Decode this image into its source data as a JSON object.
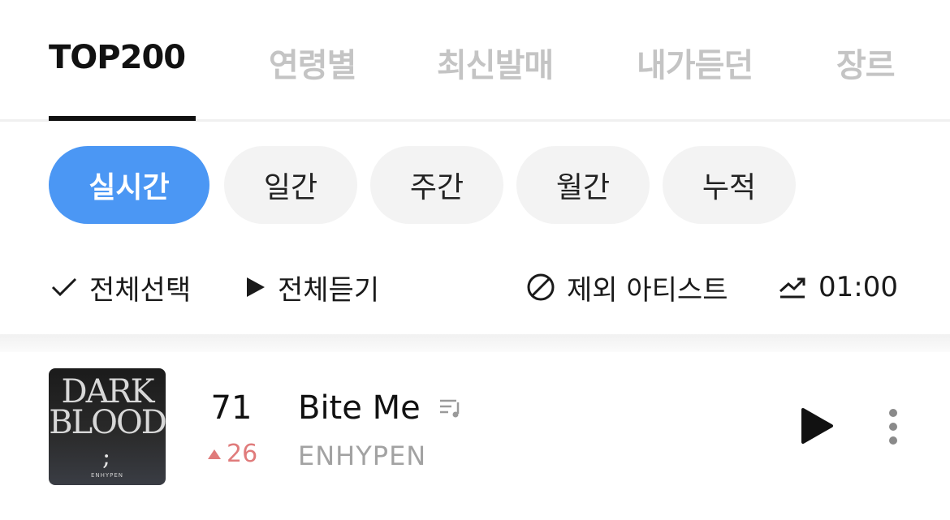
{
  "tabs": [
    {
      "label": "TOP200",
      "active": true
    },
    {
      "label": "연령별",
      "active": false
    },
    {
      "label": "최신발매",
      "active": false
    },
    {
      "label": "내가듣던",
      "active": false
    },
    {
      "label": "장르",
      "active": false
    }
  ],
  "periods": [
    {
      "label": "실시간",
      "active": true
    },
    {
      "label": "일간",
      "active": false
    },
    {
      "label": "주간",
      "active": false
    },
    {
      "label": "월간",
      "active": false
    },
    {
      "label": "누적",
      "active": false
    }
  ],
  "actions": {
    "select_all": "전체선택",
    "play_all": "전체듣기",
    "exclude_artist": "제외 아티스트",
    "chart_time": "01:00"
  },
  "song": {
    "rank": "71",
    "rank_change": "26",
    "rank_direction": "up",
    "title": "Bite Me",
    "artist": "ENHYPEN",
    "cover": {
      "line1": "DARK",
      "line2": "BLOOD",
      "mark": ";",
      "small": "ENHYPEN"
    }
  },
  "colors": {
    "accent": "#4b97f4",
    "rank_up": "#e07b7b",
    "inactive_tab": "#c4c4c4"
  }
}
